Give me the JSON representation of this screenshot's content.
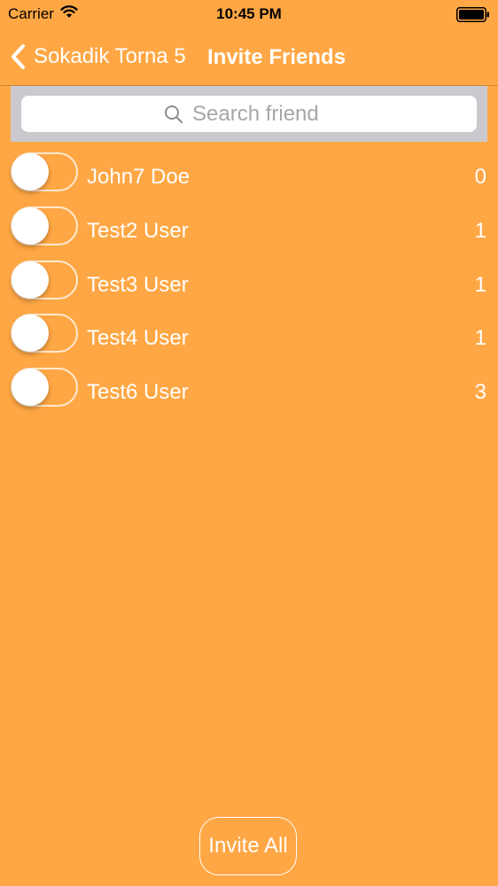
{
  "status_bar": {
    "carrier": "Carrier",
    "time": "10:45 PM",
    "icons": [
      "wifi-icon",
      "battery-icon"
    ]
  },
  "nav": {
    "back_label": "Sokadik Torna 5",
    "title": "Invite Friends",
    "back_icon": "chevron-left-icon"
  },
  "search": {
    "placeholder": "Search friend",
    "value": "",
    "icon": "search-icon"
  },
  "friends": [
    {
      "name": "John7 Doe",
      "count": "0",
      "invited": false
    },
    {
      "name": "Test2 User",
      "count": "1",
      "invited": false
    },
    {
      "name": "Test3 User",
      "count": "1",
      "invited": false
    },
    {
      "name": "Test4 User",
      "count": "1",
      "invited": false
    },
    {
      "name": "Test6 User",
      "count": "3",
      "invited": false
    }
  ],
  "footer": {
    "invite_all_label": "Invite All"
  },
  "colors": {
    "background": "#FFA744",
    "search_bar_bg": "#C9C9CE",
    "text": "#FFFFFF"
  }
}
